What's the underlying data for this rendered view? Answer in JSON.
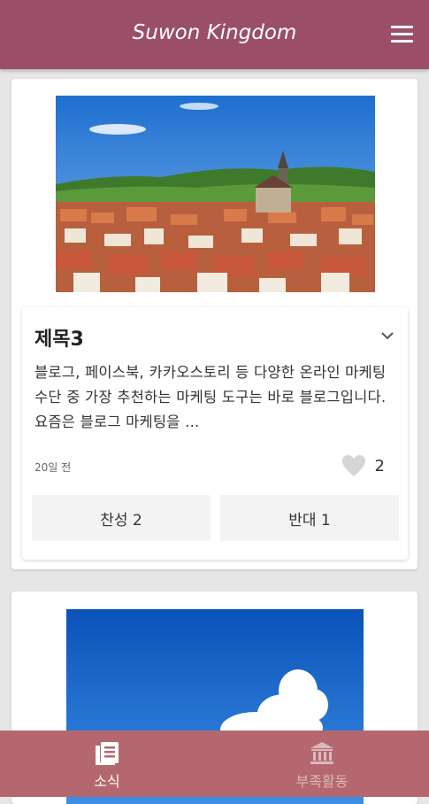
{
  "app": {
    "title": "Suwon Kingdom"
  },
  "post": {
    "title": "제목3",
    "body": "블로그, 페이스북, 카카오스토리 등 다양한 온라인 마케팅 수단 중 가장 추천하는 마케팅 도구는 바로 블로그입니다. 요즘은 블로그 마케팅을 ...",
    "time": "20일 전",
    "likes": "2",
    "agree_label": "찬성 2",
    "disagree_label": "반대 1"
  },
  "nav": [
    {
      "label": "소식",
      "icon": "news-icon",
      "active": true
    },
    {
      "label": "부족활동",
      "icon": "bank-icon",
      "active": false
    }
  ],
  "colors": {
    "topbar": "#9a4e68",
    "bottomnav": "#b5676f"
  }
}
